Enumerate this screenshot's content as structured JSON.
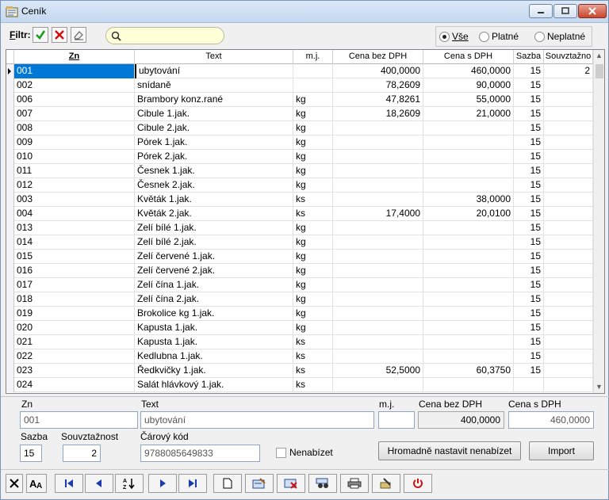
{
  "window": {
    "title": "Ceník"
  },
  "filter": {
    "label_prefix": "F",
    "label_rest": "iltr:",
    "search_value": "",
    "radios": [
      {
        "label": "Vše",
        "selected": true
      },
      {
        "label": "Platné",
        "selected": false
      },
      {
        "label": "Neplatné",
        "selected": false
      }
    ]
  },
  "grid": {
    "columns": [
      "Zn",
      "Text",
      "m.j.",
      "Cena bez DPH",
      "Cena s DPH",
      "Sazba",
      "Souvztažno"
    ],
    "rows": [
      [
        "001",
        "ubytování",
        "",
        "400,0000",
        "460,0000",
        "15",
        "2"
      ],
      [
        "002",
        "snídaně",
        "",
        "78,2609",
        "90,0000",
        "15",
        ""
      ],
      [
        "006",
        "Brambory konz.rané",
        "kg",
        "47,8261",
        "55,0000",
        "15",
        ""
      ],
      [
        "007",
        "Cibule 1.jak.",
        "kg",
        "18,2609",
        "21,0000",
        "15",
        ""
      ],
      [
        "008",
        "Cibule 2.jak.",
        "kg",
        "",
        "",
        "15",
        ""
      ],
      [
        "009",
        "Pórek 1.jak.",
        "kg",
        "",
        "",
        "15",
        ""
      ],
      [
        "010",
        "Pórek 2.jak.",
        "kg",
        "",
        "",
        "15",
        ""
      ],
      [
        "011",
        "Česnek 1.jak.",
        "kg",
        "",
        "",
        "15",
        ""
      ],
      [
        "012",
        "Česnek 2.jak.",
        "kg",
        "",
        "",
        "15",
        ""
      ],
      [
        "003",
        "Květák 1.jak.",
        "ks",
        "",
        "38,0000",
        "15",
        ""
      ],
      [
        "004",
        "Květák 2.jak.",
        "ks",
        "17,4000",
        "20,0100",
        "15",
        ""
      ],
      [
        "013",
        "Zelí bílé 1.jak.",
        "kg",
        "",
        "",
        "15",
        ""
      ],
      [
        "014",
        "Zelí bílé 2.jak.",
        "kg",
        "",
        "",
        "15",
        ""
      ],
      [
        "015",
        "Zelí červené 1.jak.",
        "kg",
        "",
        "",
        "15",
        ""
      ],
      [
        "016",
        "Zelí červené 2.jak.",
        "kg",
        "",
        "",
        "15",
        ""
      ],
      [
        "017",
        "Zelí čína 1.jak.",
        "kg",
        "",
        "",
        "15",
        ""
      ],
      [
        "018",
        "Zelí čína 2.jak.",
        "kg",
        "",
        "",
        "15",
        ""
      ],
      [
        "019",
        "Brokolice kg 1.jak.",
        "kg",
        "",
        "",
        "15",
        ""
      ],
      [
        "020",
        "Kapusta 1.jak.",
        "kg",
        "",
        "",
        "15",
        ""
      ],
      [
        "021",
        "Kapusta 1.jak.",
        "ks",
        "",
        "",
        "15",
        ""
      ],
      [
        "022",
        "Kedlubna 1.jak.",
        "ks",
        "",
        "",
        "15",
        ""
      ],
      [
        "023",
        "Ředkvičky 1.jak.",
        "ks",
        "52,5000",
        "60,3750",
        "15",
        ""
      ],
      [
        "024",
        "Salát hlávkový 1.jak.",
        "ks",
        "",
        "",
        "",
        ""
      ]
    ]
  },
  "detail": {
    "zn_label": "Zn",
    "zn_value": "001",
    "text_label": "Text",
    "text_value": "ubytování",
    "mj_label": "m.j.",
    "mj_value": "",
    "cena_bez_label": "Cena bez DPH",
    "cena_bez_value": "400,0000",
    "cena_s_label": "Cena s DPH",
    "cena_s_value": "460,0000",
    "sazba_label": "Sazba",
    "sazba_value": "15",
    "souv_label": "Souvztažnost",
    "souv_value": "2",
    "carovy_label": "Čárový kód",
    "carovy_value": "9788085649833",
    "nenabizet_label": "Nenabízet",
    "hromadne_button": "Hromadně nastavit nenabízet",
    "import_button": "Import"
  },
  "colors": {
    "selection": "#0078d7",
    "search_bg": "#ffffd8"
  }
}
